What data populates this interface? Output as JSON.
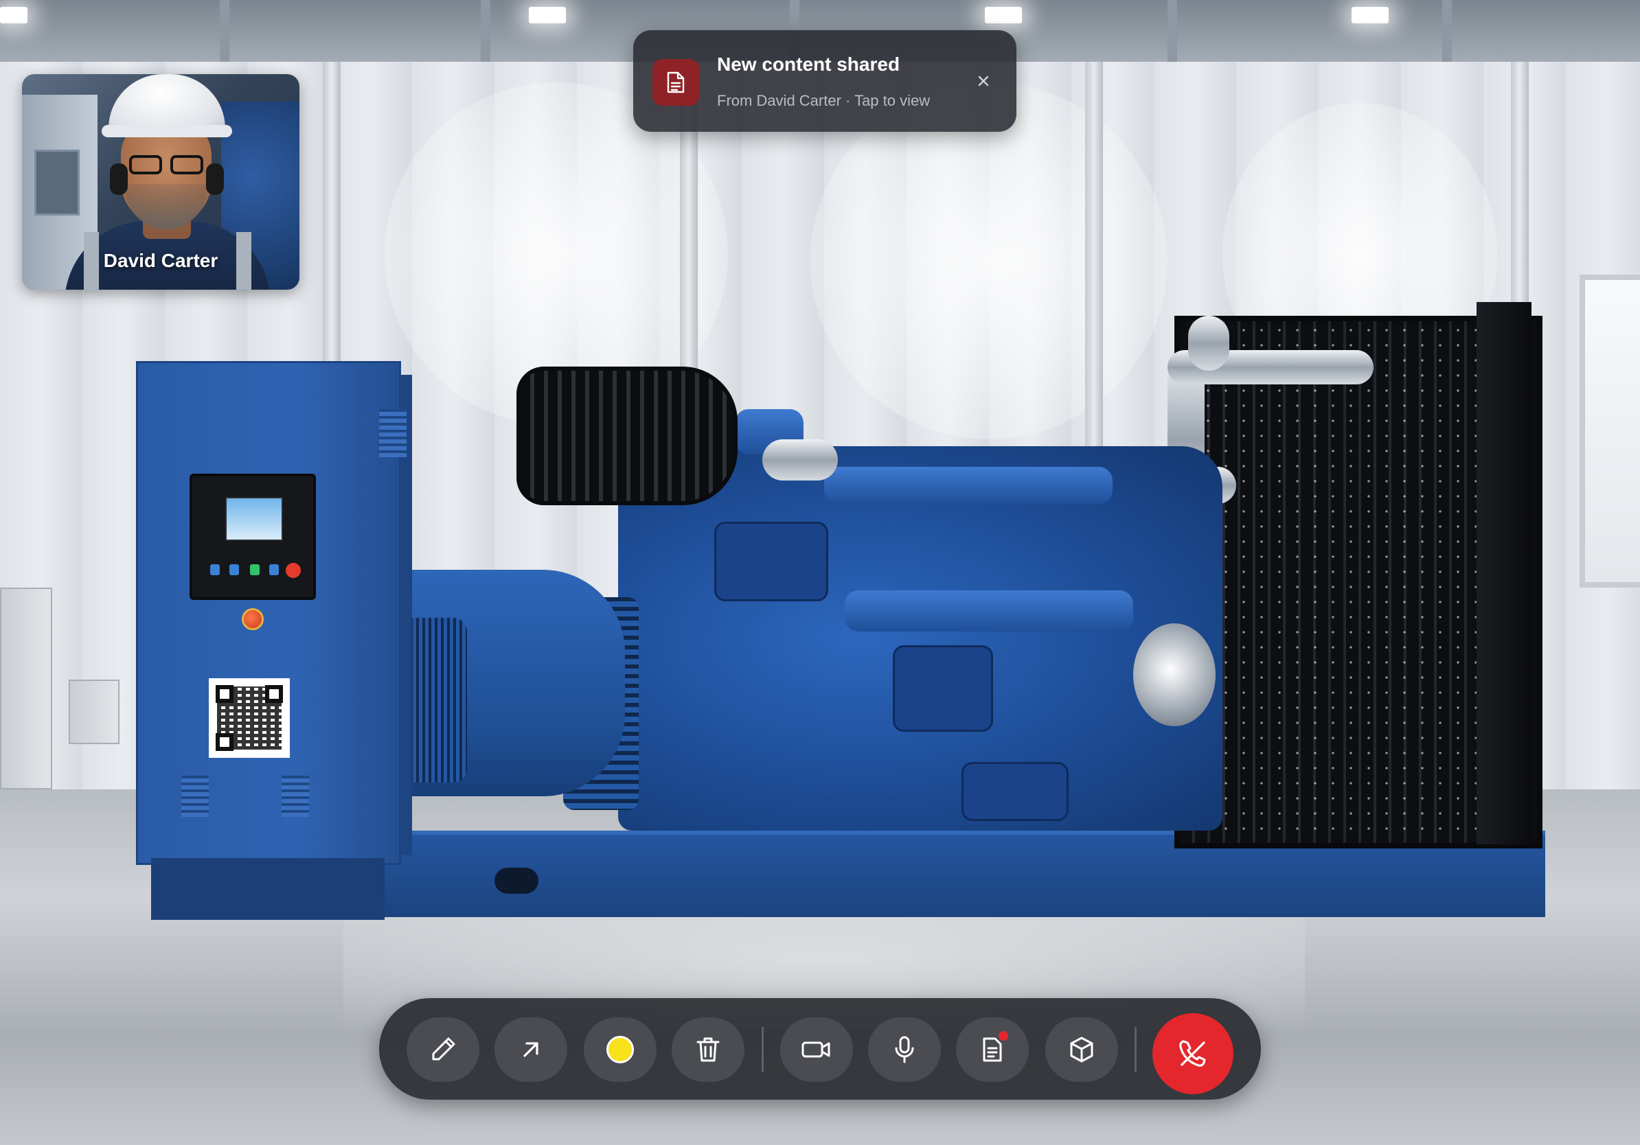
{
  "participant": {
    "name": "David Carter"
  },
  "notification": {
    "title": "New content shared",
    "subtitle": "From David Carter · Tap to view",
    "icon": "document-icon",
    "close_icon": "close-icon"
  },
  "toolbar": {
    "buttons": [
      {
        "id": "pen",
        "icon": "pencil-icon"
      },
      {
        "id": "arrow",
        "icon": "arrow-up-right-icon"
      },
      {
        "id": "color",
        "icon": "color-swatch",
        "color": "#f7e21b"
      },
      {
        "id": "delete",
        "icon": "trash-icon"
      },
      {
        "id": "camera",
        "icon": "video-camera-icon"
      },
      {
        "id": "microphone",
        "icon": "microphone-icon"
      },
      {
        "id": "documents",
        "icon": "document-list-icon",
        "has_badge": true
      },
      {
        "id": "ar-model",
        "icon": "cube-icon"
      },
      {
        "id": "end-call",
        "icon": "phone-hangup-icon",
        "color": "#e4272d"
      }
    ]
  },
  "colors": {
    "accent_red": "#e4272d",
    "toast_icon_bg": "#8e2226",
    "toolbar_bg": "#28292e",
    "button_bg": "#4a4c52"
  }
}
